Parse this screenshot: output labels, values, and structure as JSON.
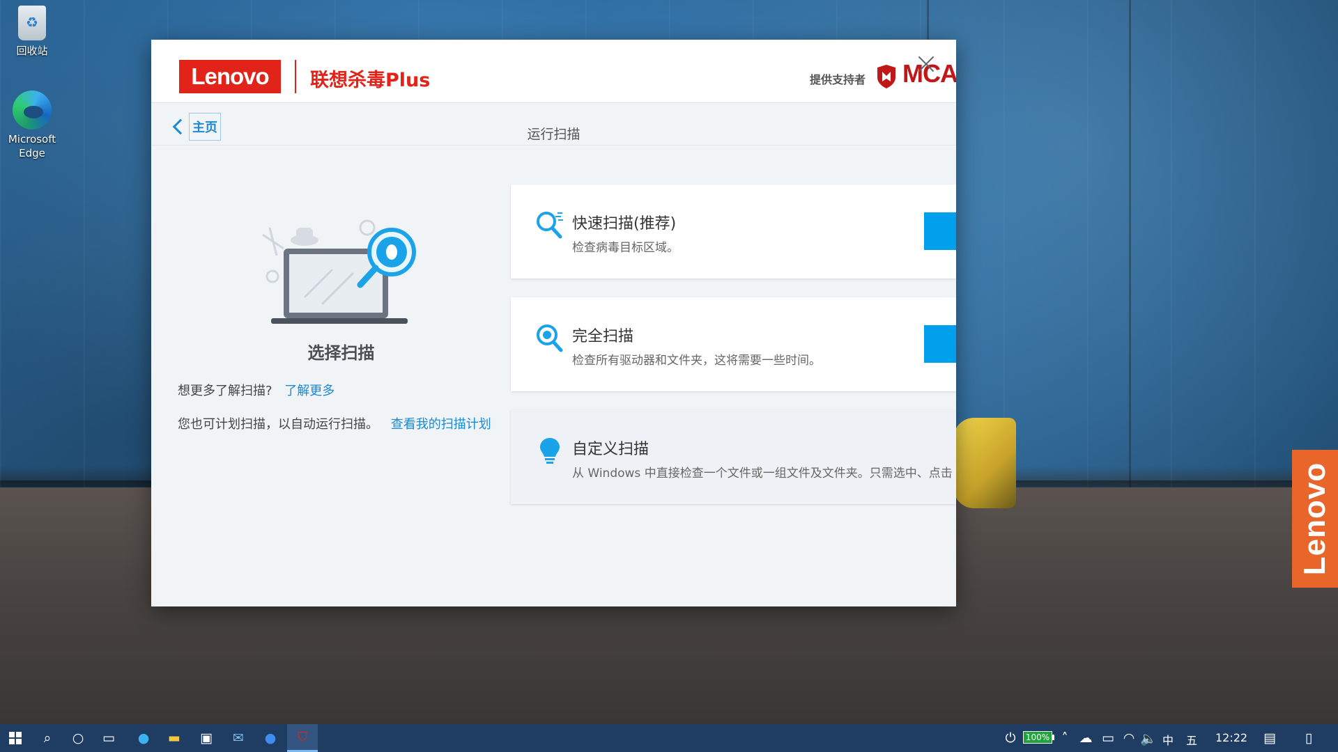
{
  "desktop": {
    "icons": [
      {
        "label": "回收站"
      },
      {
        "label": "Microsoft Edge"
      }
    ],
    "side_tab": "Lenovo"
  },
  "window": {
    "logo": "Lenovo",
    "app_title": "联想杀毒Plus",
    "support_label": "提供支持者",
    "partner_logo": "MCA",
    "back_label": "主页",
    "page_title": "运行扫描",
    "left": {
      "title": "选择扫描",
      "learn_prefix": "想更多了解扫描?",
      "learn_link": "了解更多",
      "schedule_prefix": "您也可计划扫描，以自动运行扫描。",
      "schedule_link": "查看我的扫描计划"
    },
    "scans": [
      {
        "title": "快速扫描(推荐)",
        "desc": "检查病毒目标区域。",
        "icon": "quick-scan-icon"
      },
      {
        "title": "完全扫描",
        "desc": "检查所有驱动器和文件夹，这将需要一些时间。",
        "icon": "full-scan-icon"
      },
      {
        "title": "自定义扫描",
        "desc": "从 Windows 中直接检查一个文件或一组文件及文件夹。只需选中、点击",
        "icon": "custom-scan-icon"
      }
    ],
    "colors": {
      "brand_red": "#e2231a",
      "accent_blue": "#00a0ec",
      "link_blue": "#1a8ad4"
    }
  },
  "taskbar": {
    "battery": "100%",
    "ime": "中",
    "ime2": "五",
    "time": "12:22"
  }
}
